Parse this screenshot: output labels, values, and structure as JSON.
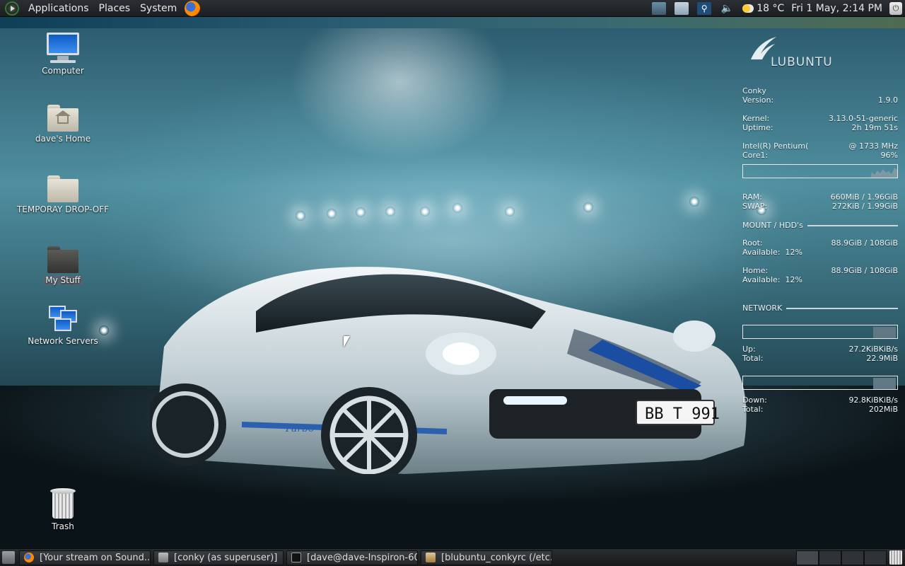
{
  "top_panel": {
    "menus": [
      "Applications",
      "Places",
      "System"
    ],
    "weather": "18 °C",
    "clock": "Fri  1 May,  2:14 PM"
  },
  "desktop_icons": [
    {
      "label": "Computer"
    },
    {
      "label": "dave's Home"
    },
    {
      "label": "TEMPORAY DROP-OFF"
    },
    {
      "label": "My Stuff"
    },
    {
      "label": "Network Servers"
    },
    {
      "label": "Trash"
    }
  ],
  "wallpaper": {
    "plate": "BB T 991",
    "side_script": "Turbo"
  },
  "conky": {
    "logo_text": "LUBUNTU",
    "app_name": "Conky",
    "version_label": "Version:",
    "version": "1.9.0",
    "kernel_label": "Kernel:",
    "kernel": "3.13.0-51-generic",
    "uptime_label": "Uptime:",
    "uptime": "2h 19m 51s",
    "cpu_label": "Intel(R) Pentium(",
    "cpu_freq": "@ 1733 MHz",
    "core_label": "Core1:",
    "core": "96%",
    "ram_label": "RAM:",
    "ram": "660MiB  /  1.96GiB",
    "swap_label": "SWAP:",
    "swap": "272KiB  /  1.99GiB",
    "mount_heading": "MOUNT / HDD's",
    "root_label": "Root:",
    "root": "88.9GiB  /  108GiB",
    "root_avail_label": "Available:",
    "root_avail": "12%",
    "home_label": "Home:",
    "home": "88.9GiB  /  108GiB",
    "home_avail_label": "Available:",
    "home_avail": "12%",
    "network_heading": "NETWORK",
    "up_label": "Up:",
    "up": "27.2KiBKiB/s",
    "up_total_label": "Total:",
    "up_total": "22.9MiB",
    "down_label": "Down:",
    "down": "92.8KiBKiB/s",
    "down_total_label": "Total:",
    "down_total": "202MiB"
  },
  "taskbar": {
    "tasks": [
      {
        "label": "[Your stream on Sound...",
        "icon": "firefox-icon"
      },
      {
        "label": "[conky (as superuser)]",
        "icon": "window-icon"
      },
      {
        "label": "[dave@dave-Inspiron-60...",
        "icon": "terminal-icon"
      },
      {
        "label": "[blubuntu_conkyrc (/etc...",
        "icon": "text-editor-icon"
      }
    ]
  },
  "colors": {
    "panel_bg": "#1b1e21",
    "accent_strip": "#2a5d74",
    "conky_text": "#eef4f7"
  }
}
